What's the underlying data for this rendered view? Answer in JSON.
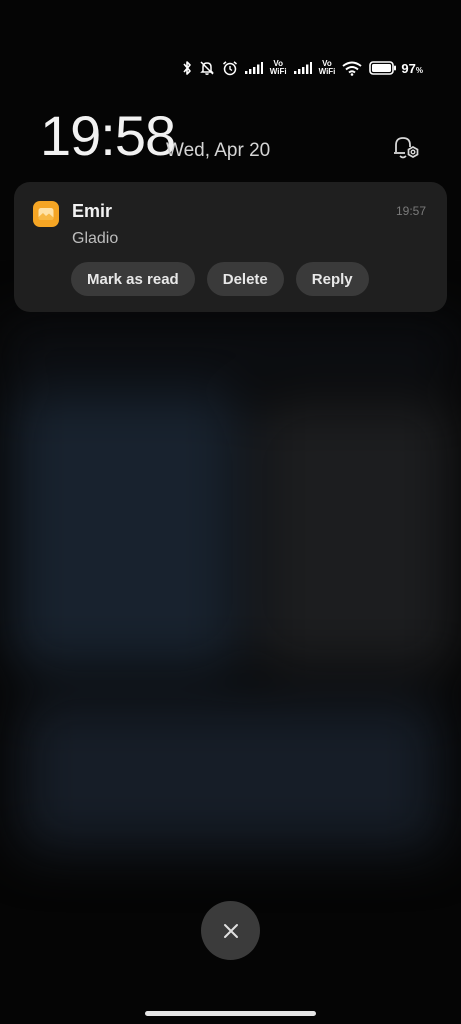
{
  "status_bar": {
    "icons": [
      "bluetooth-icon",
      "silent-bell-icon",
      "alarm-icon",
      "signal-icon",
      "vowifi-icon",
      "signal-icon",
      "vowifi-icon",
      "wifi-icon",
      "battery-icon"
    ],
    "vowifi_line1": "Vo",
    "vowifi_line2": "WiFi",
    "battery_percent": "97",
    "battery_unit": "%"
  },
  "lockscreen": {
    "time": "19:58",
    "date": "Wed, Apr 20",
    "settings_icon": "notification-settings-icon"
  },
  "notification": {
    "app_icon": "gallery-icon",
    "app_color": "#f5a524",
    "sender": "Emir",
    "time": "19:57",
    "message": "Gladio",
    "actions": {
      "mark_read": "Mark as read",
      "delete": "Delete",
      "reply": "Reply"
    }
  },
  "controls": {
    "close_icon": "close-icon"
  }
}
